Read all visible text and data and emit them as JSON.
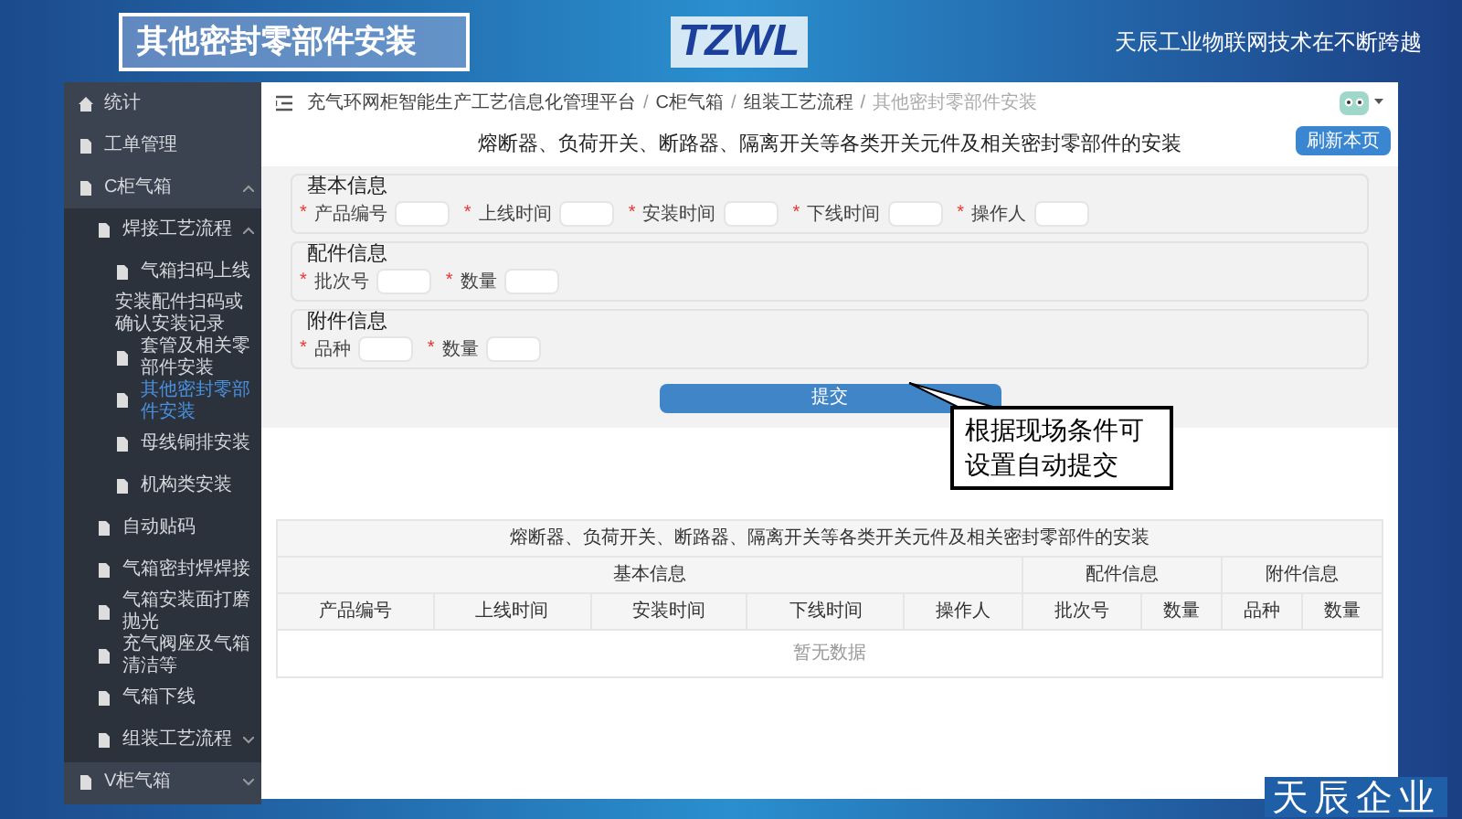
{
  "header": {
    "title": "其他密封零部件安装",
    "logo_text": "TZWL",
    "slogan": "天辰工业物联网技术在不断跨越"
  },
  "sidebar": {
    "items": [
      {
        "label": "统计",
        "kind": "home",
        "selected": false
      },
      {
        "label": "工单管理",
        "kind": "page",
        "selected": false
      },
      {
        "label": "C柜气箱",
        "kind": "page",
        "selected": false,
        "expanded": true,
        "children": [
          {
            "label": "焊接工艺流程",
            "kind": "page",
            "selected": false,
            "expanded": true,
            "children": [
              {
                "label": "气箱扫码上线",
                "kind": "page",
                "selected": false
              },
              {
                "label": "安装配件扫码或确认安装记录",
                "kind": "text",
                "selected": false
              },
              {
                "label": "套管及相关零部件安装",
                "kind": "page",
                "selected": false
              },
              {
                "label": "其他密封零部件安装",
                "kind": "page",
                "selected": true
              },
              {
                "label": "母线铜排安装",
                "kind": "page",
                "selected": false
              },
              {
                "label": "机构类安装",
                "kind": "page",
                "selected": false
              }
            ]
          },
          {
            "label": "自动贴码",
            "kind": "page",
            "selected": false
          },
          {
            "label": "气箱密封焊焊接",
            "kind": "page",
            "selected": false
          },
          {
            "label": "气箱安装面打磨抛光",
            "kind": "page",
            "selected": false
          },
          {
            "label": "充气阀座及气箱清洁等",
            "kind": "page",
            "selected": false
          },
          {
            "label": "气箱下线",
            "kind": "page",
            "selected": false
          },
          {
            "label": "组装工艺流程",
            "kind": "page",
            "selected": false,
            "expanded": false
          }
        ]
      },
      {
        "label": "V柜气箱",
        "kind": "page",
        "selected": false,
        "expanded": false
      }
    ]
  },
  "breadcrumb_separator": "/",
  "required_mark": "*",
  "breadcrumb": [
    "充气环网柜智能生产工艺信息化管理平台",
    "C柜气箱",
    "组装工艺流程",
    "其他密封零部件安装"
  ],
  "page_title": "熔断器、负荷开关、断路器、隔离开关等各类开关元件及相关密封零部件的安装",
  "refresh_button": "刷新本页",
  "form_sections": [
    {
      "title": "基本信息",
      "fields": [
        {
          "label": "产品编号",
          "required": true
        },
        {
          "label": "上线时间",
          "required": true
        },
        {
          "label": "安装时间",
          "required": true
        },
        {
          "label": "下线时间",
          "required": true
        },
        {
          "label": "操作人",
          "required": true
        }
      ]
    },
    {
      "title": "配件信息",
      "fields": [
        {
          "label": "批次号",
          "required": true
        },
        {
          "label": "数量",
          "required": true
        }
      ]
    },
    {
      "title": "附件信息",
      "fields": [
        {
          "label": "品种",
          "required": true
        },
        {
          "label": "数量",
          "required": true
        }
      ]
    }
  ],
  "submit_button": "提交",
  "callout": "根据现场条件可设置自动提交",
  "table": {
    "caption": "熔断器、负荷开关、断路器、隔离开关等各类开关元件及相关密封零部件的安装",
    "groups": [
      {
        "label": "基本信息",
        "columns": [
          "产品编号",
          "上线时间",
          "安装时间",
          "下线时间",
          "操作人"
        ]
      },
      {
        "label": "配件信息",
        "columns": [
          "批次号",
          "数量"
        ]
      },
      {
        "label": "附件信息",
        "columns": [
          "品种",
          "数量"
        ]
      }
    ],
    "empty_text": "暂无数据"
  },
  "footer_brand": "天辰企业"
}
